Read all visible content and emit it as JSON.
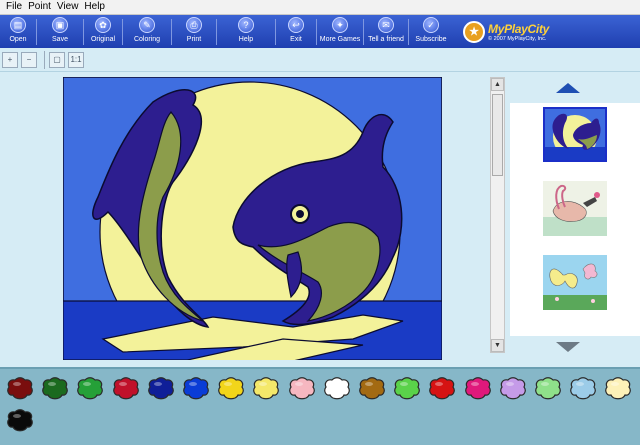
{
  "menu": [
    "File",
    "Point",
    "View",
    "Help"
  ],
  "toolbar": [
    {
      "label": "Open",
      "icon": "folder-icon",
      "glyph": "▤"
    },
    {
      "label": "Save",
      "icon": "disk-icon",
      "glyph": "▣"
    },
    {
      "label": "Original",
      "icon": "palette-icon",
      "glyph": "✿"
    },
    {
      "label": "Coloring",
      "icon": "brush-icon",
      "glyph": "✎"
    },
    {
      "label": "Print",
      "icon": "printer-icon",
      "glyph": "⎙"
    },
    {
      "label": "Help",
      "icon": "help-icon",
      "glyph": "?"
    },
    {
      "label": "Exit",
      "icon": "exit-icon",
      "glyph": "↩"
    },
    {
      "label": "More Games",
      "icon": "games-icon",
      "glyph": "✦"
    },
    {
      "label": "Tell a friend",
      "icon": "mail-icon",
      "glyph": "✉"
    },
    {
      "label": "Subscribe",
      "icon": "subscribe-icon",
      "glyph": "✓"
    }
  ],
  "logo": {
    "name": "MyPlayCity",
    "copyright": "© 2007 MyPlayCity, Inc."
  },
  "zoom": [
    {
      "name": "zoom-in-icon",
      "glyph": "+"
    },
    {
      "name": "zoom-out-icon",
      "glyph": "−"
    },
    {
      "name": "fit-icon",
      "glyph": "▢"
    },
    {
      "name": "actual-size-icon",
      "glyph": "1:1"
    }
  ],
  "canvas": {
    "colors": {
      "sky": "#3f6ee0",
      "moon": "#f3f29a",
      "sea": "#1a3bc5",
      "dolphin": "#2d1e8f",
      "belly": "#8c9d4b",
      "dark": "#0b0b30"
    }
  },
  "thumbnails": [
    {
      "name": "thumb-dolphins",
      "selected": true
    },
    {
      "name": "thumb-flamingo",
      "selected": false
    },
    {
      "name": "thumb-butterfly",
      "selected": false
    }
  ],
  "palette": [
    "#7a0e0e",
    "#1b6a1f",
    "#25a038",
    "#c0112a",
    "#0f1e98",
    "#0a3cd6",
    "#f2d51a",
    "#f4e86a",
    "#f6b7c0",
    "#ffffff",
    "#a36a12",
    "#5ad24a",
    "#d61313",
    "#e0197b",
    "#c59be8",
    "#8fe08a",
    "#9ccce8",
    "#fdf1b8",
    "#0a0a0a"
  ]
}
